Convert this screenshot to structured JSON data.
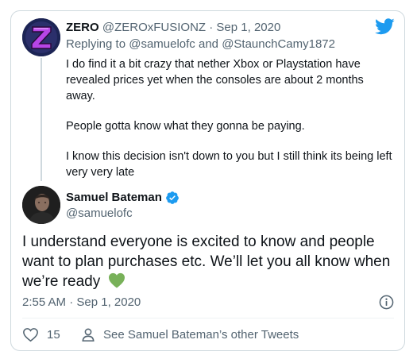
{
  "parent_tweet": {
    "display_name": "ZERO",
    "handle": "@ZEROxFUSIONZ",
    "separator": "·",
    "date": "Sep 1, 2020",
    "replying_prefix": "Replying to",
    "replying_user_1": "@samuelofc",
    "replying_and": "and",
    "replying_user_2": "@StaunchCamy1872",
    "paragraphs": [
      "I do find it a bit crazy that nether Xbox or Playstation have revealed prices yet when the consoles are about 2 months away.",
      "People gotta know what they gonna be paying.",
      "I know this decision isn't down to you but I still think its being left very very late"
    ]
  },
  "main_tweet": {
    "display_name": "Samuel Bateman",
    "handle": "@samuelofc",
    "text": "I understand everyone is excited to know and people want to plan purchases etc. We’ll let you all know when we’re ready",
    "timestamp": "2:55 AM · Sep 1, 2020",
    "like_count": "15",
    "profile_link": "See Samuel Bateman’s other Tweets"
  },
  "colors": {
    "twitter_blue": "#1d9bf0",
    "muted_text": "#536471",
    "border": "#cfd9de",
    "heart_green": "#78b159"
  },
  "icons": {
    "logo": "twitter-bird-icon",
    "verified": "verified-badge-icon",
    "emoji": "green-heart-emoji",
    "info": "info-icon",
    "like": "heart-outline-icon",
    "profile": "person-icon"
  }
}
